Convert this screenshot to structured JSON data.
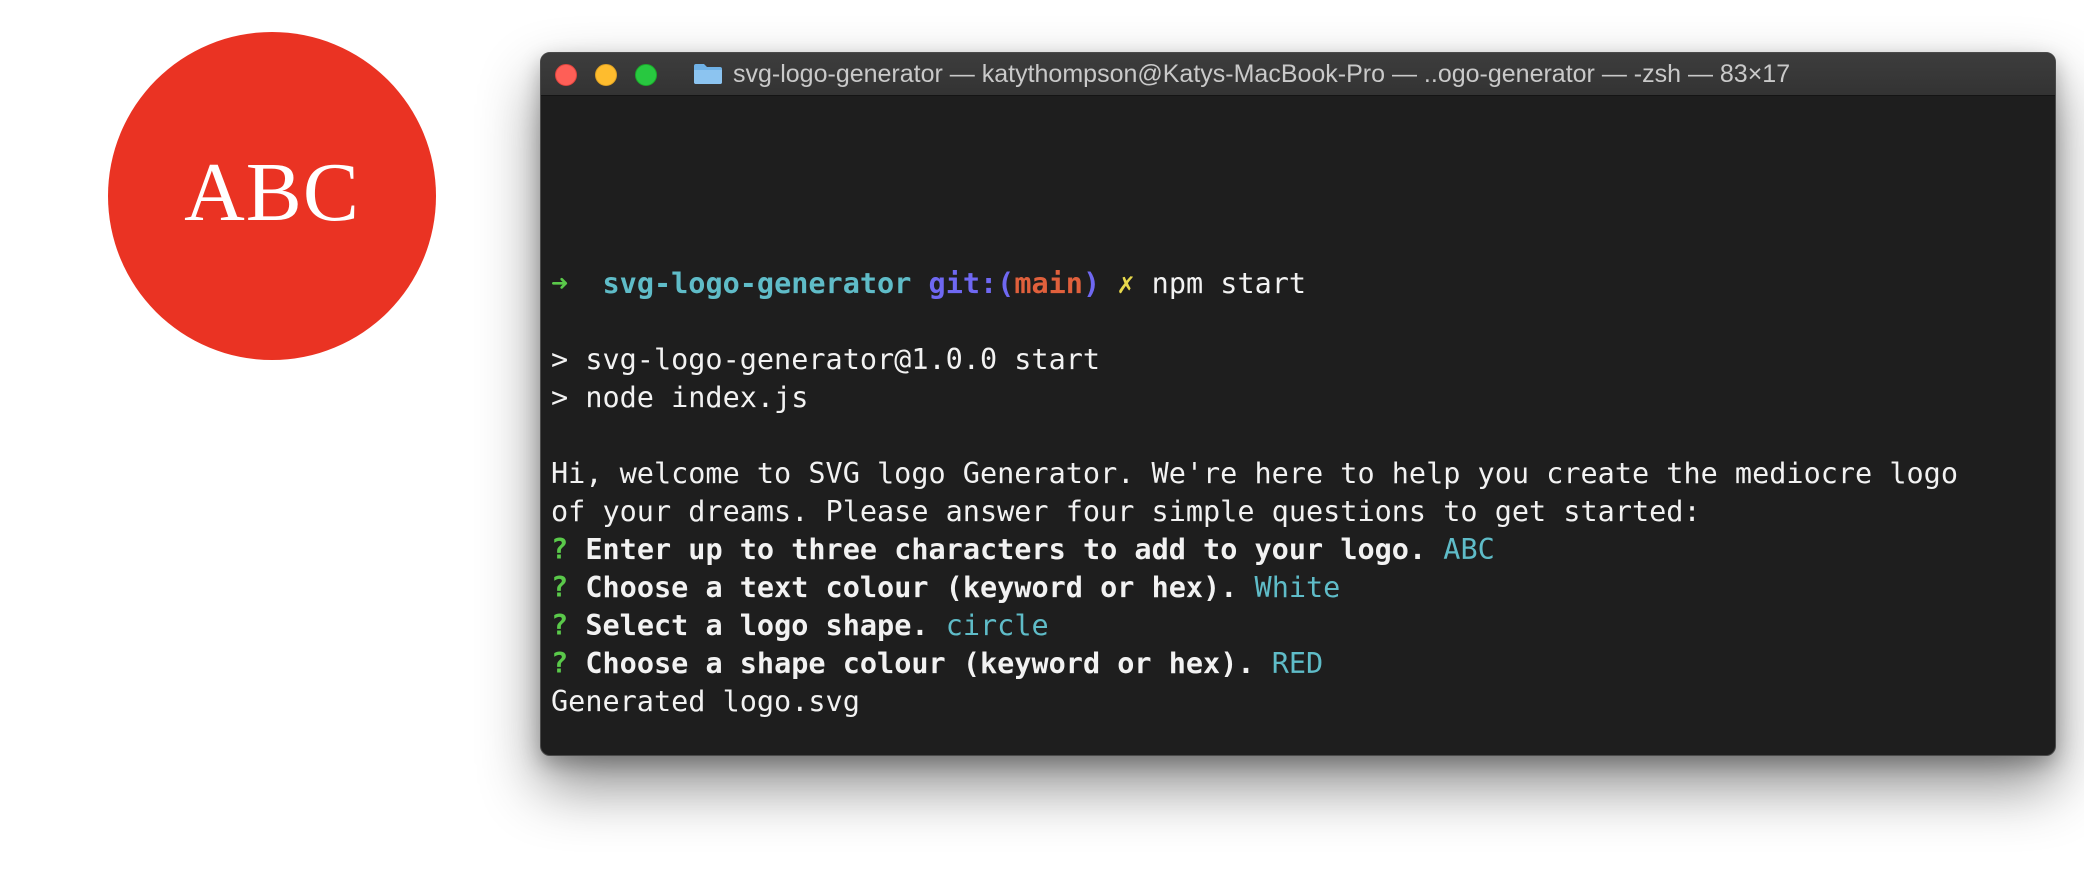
{
  "logo": {
    "text": "ABC",
    "fill_color": "#ea3323",
    "text_color": "#ffffff"
  },
  "window": {
    "title": "svg-logo-generator — katythompson@Katys-MacBook-Pro — ..ogo-generator — -zsh — 83×17",
    "icons": [
      "close-icon",
      "minimize-icon",
      "zoom-icon",
      "folder-icon"
    ]
  },
  "terminal": {
    "prompt": {
      "arrow": "➜",
      "directory": "svg-logo-generator",
      "git_prefix": "git:(",
      "branch": "main",
      "git_suffix": ")",
      "dirty_mark": "✗",
      "command": "npm start"
    },
    "script_lines": [
      "> svg-logo-generator@1.0.0 start",
      "> node index.js"
    ],
    "welcome_lines": [
      "Hi, welcome to SVG logo Generator. We're here to help you create the mediocre logo",
      "of your dreams. Please answer four simple questions to get started:"
    ],
    "questions": [
      {
        "marker": "?",
        "question": "Enter up to three characters to add to your logo.",
        "answer": "ABC"
      },
      {
        "marker": "?",
        "question": "Choose a text colour (keyword or hex).",
        "answer": "White"
      },
      {
        "marker": "?",
        "question": "Select a logo shape.",
        "answer": "circle"
      },
      {
        "marker": "?",
        "question": "Choose a shape colour (keyword or hex).",
        "answer": "RED"
      }
    ],
    "result": "Generated logo.svg"
  }
}
